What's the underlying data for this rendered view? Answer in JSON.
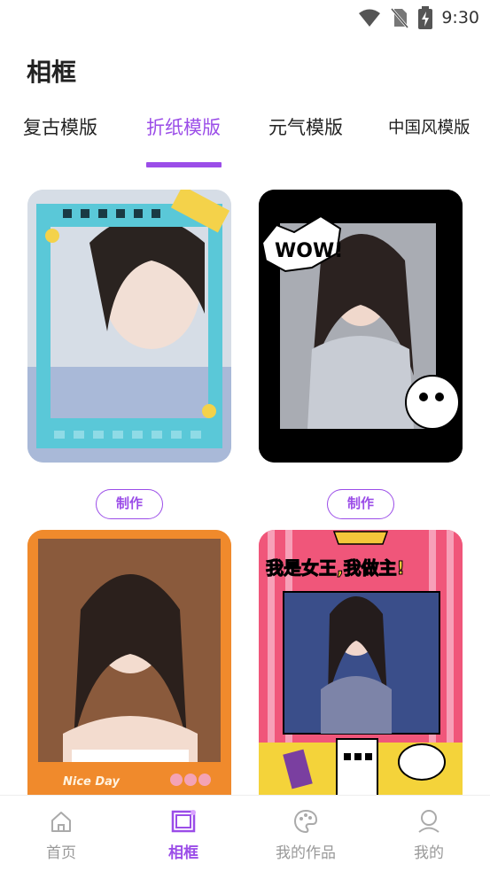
{
  "status_bar": {
    "time": "9:30",
    "icons": [
      "wifi-icon",
      "no-sim-icon",
      "battery-charging-icon"
    ]
  },
  "page": {
    "title": "相框"
  },
  "tabs": [
    {
      "label": "复古模版",
      "active": false
    },
    {
      "label": "折纸模版",
      "active": true
    },
    {
      "label": "元气模版",
      "active": false
    },
    {
      "label": "中国风模版",
      "active": false
    }
  ],
  "cards": [
    {
      "frame": "film-strip-frame",
      "button_label": "制作"
    },
    {
      "frame": "comic-wow-frame",
      "sticker_text": "WOW!",
      "button_label": "制作"
    },
    {
      "frame": "orange-polaroid-frame",
      "sticker_text": "Nice Day"
    },
    {
      "frame": "queen-comic-frame",
      "sticker_text": "我是女王,我做主!"
    }
  ],
  "bottom_nav": [
    {
      "label": "首页",
      "icon": "home-icon",
      "active": false
    },
    {
      "label": "相框",
      "icon": "frame-icon",
      "active": true
    },
    {
      "label": "我的作品",
      "icon": "palette-icon",
      "active": false
    },
    {
      "label": "我的",
      "icon": "user-icon",
      "active": false
    }
  ],
  "colors": {
    "accent": "#9b4de8",
    "inactive_nav": "#999999"
  }
}
